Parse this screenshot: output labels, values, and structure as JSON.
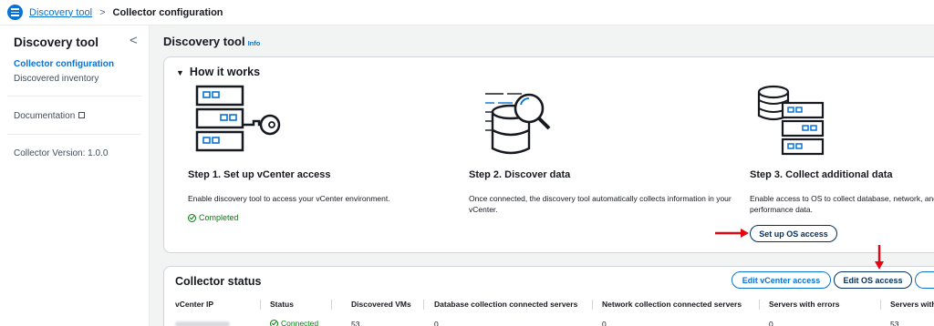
{
  "breadcrumb": {
    "root": "Discovery tool",
    "separator": ">",
    "current": "Collector configuration"
  },
  "sidebar": {
    "title": "Discovery tool",
    "collapse_glyph": "<",
    "items": [
      {
        "label": "Collector configuration"
      },
      {
        "label": "Discovered inventory"
      },
      {
        "label": "Documentation"
      },
      {
        "label": "Collector Version: 1.0.0"
      }
    ]
  },
  "page": {
    "title": "Discovery tool",
    "info": "Info"
  },
  "how_it_works": {
    "toggle_glyph": "▼",
    "title": "How it works",
    "steps": [
      {
        "title": "Step 1. Set up vCenter access",
        "description": "Enable discovery tool to access your vCenter environment.",
        "status": "Completed"
      },
      {
        "title": "Step 2. Discover data",
        "description": "Once connected, the discovery tool automatically collects information in your vCenter."
      },
      {
        "title": "Step 3. Collect additional data",
        "description": "Enable access to OS to collect database, network, and performance data.",
        "button": "Set up OS access"
      }
    ]
  },
  "collector_status": {
    "title": "Collector status",
    "buttons": {
      "edit_vcenter": "Edit vCenter access",
      "edit_os": "Edit OS access"
    },
    "columns": [
      "vCenter IP",
      "Status",
      "Discovered VMs",
      "Database collection connected servers",
      "Network collection connected servers",
      "Servers with errors",
      "Servers with"
    ],
    "rows": [
      {
        "status": "Connected",
        "discovered_vms": "53",
        "database": "0",
        "network": "0",
        "errors": "0",
        "servers_with": "53"
      }
    ]
  },
  "colors": {
    "accent": "#0972d3",
    "success": "#037f0c",
    "annotation_arrow": "#e3050f"
  }
}
